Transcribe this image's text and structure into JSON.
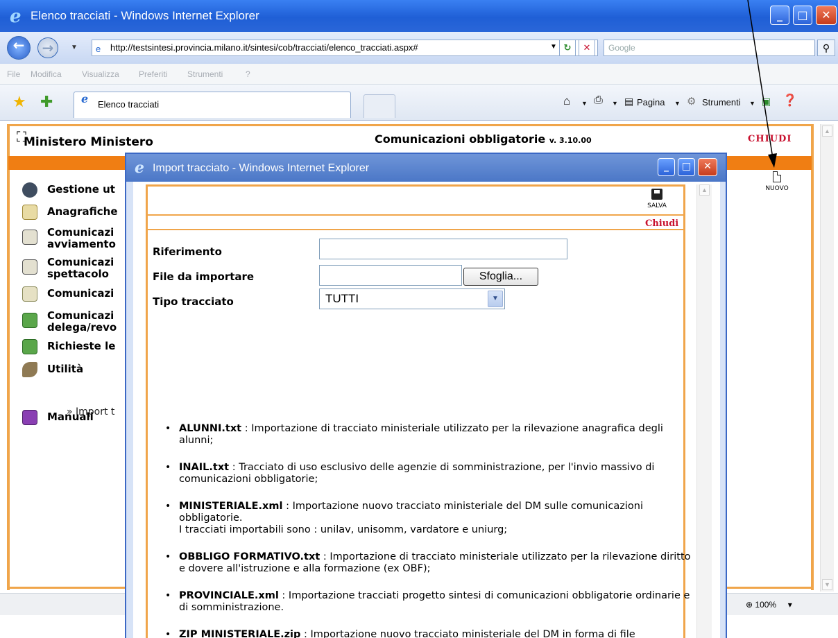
{
  "browser": {
    "title": "Elenco tracciati - Windows Internet Explorer",
    "url": "http://testsintesi.provincia.milano.it/sintesi/cob/tracciati/elenco_tracciati.aspx#",
    "search_placeholder": "Google",
    "menu": [
      "File",
      "Modifica",
      "Visualizza",
      "Preferiti",
      "Strumenti",
      "?"
    ],
    "tab_title": "Elenco tracciati",
    "commands": {
      "pagina": "Pagina",
      "strumenti": "Strumenti"
    },
    "zoom": "100%"
  },
  "app": {
    "user": "Ministero Ministero",
    "title": "Comunicazioni obbligatorie",
    "version": "v. 3.10.00",
    "close": "CHIUDI",
    "new_button": "NUOVO",
    "menu_items": [
      {
        "label": "Gestione ut",
        "icon": "users-icon"
      },
      {
        "label": "Anagrafiche",
        "icon": "tag-icon"
      },
      {
        "label": "Comunicazi\navviamento",
        "icon": "document-icon"
      },
      {
        "label": "Comunicazi\nspettacolo",
        "icon": "document-icon"
      },
      {
        "label": "Comunicazi",
        "icon": "document-icon"
      },
      {
        "label": "Comunicazi\ndelega/revo",
        "icon": "document-icon"
      },
      {
        "label": "Richieste le",
        "icon": "document-icon"
      },
      {
        "label": "Utilità",
        "icon": "tools-icon"
      },
      {
        "label": "Manuali",
        "icon": "books-icon"
      }
    ],
    "submenu": "» Import t"
  },
  "popup": {
    "title": "Import tracciato - Windows Internet Explorer",
    "save": "SALVA",
    "close": "Chiudi",
    "fields": {
      "riferimento_label": "Riferimento",
      "riferimento_value": "",
      "file_label": "File da importare",
      "file_value": "",
      "browse_button": "Sfoglia...",
      "tipo_label": "Tipo tracciato",
      "tipo_value": "TUTTI"
    },
    "formats": [
      {
        "name": "ALUNNI.txt",
        "desc": " : Importazione di tracciato ministeriale utilizzato per la rilevazione anagrafica degli alunni;"
      },
      {
        "name": "INAIL.txt",
        "desc": " : Tracciato di uso esclusivo delle agenzie di somministrazione, per l'invio massivo di comunicazioni obbligatorie;"
      },
      {
        "name": "MINISTERIALE.xml",
        "desc": " : Importazione nuovo tracciato ministeriale del DM sulle comunicazioni obbligatorie.\nI tracciati importabili sono : unilav, unisomm, vardatore e uniurg;"
      },
      {
        "name": "OBBLIGO FORMATIVO.txt",
        "desc": " : Importazione di tracciato ministeriale utilizzato per la rilevazione diritto e dovere all'istruzione e alla formazione (ex OBF);"
      },
      {
        "name": "PROVINCIALE.xml",
        "desc": " : Importazione tracciati progetto sintesi di comunicazioni obbligatorie ordinarie e di somministrazione."
      },
      {
        "name": "ZIP MINISTERIALE.zip",
        "desc": " : Importazione nuovo tracciato ministeriale del DM in forma di file compresso."
      }
    ]
  },
  "colors": {
    "accent_orange": "#f07e13",
    "frame_orange": "#f0a54a",
    "close_red": "#c8102e",
    "ie_blue": "#2a66d8"
  }
}
